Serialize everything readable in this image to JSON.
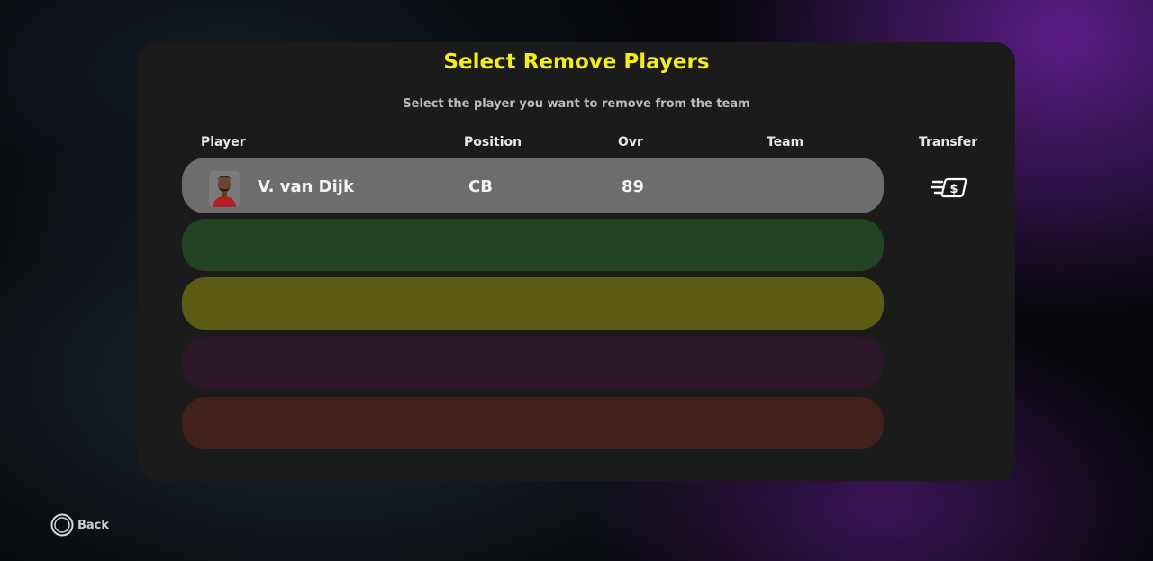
{
  "dialog": {
    "title": "Select Remove Players",
    "subtitle": "Select the player you want to remove from the team"
  },
  "columns": {
    "player": "Player",
    "position": "Position",
    "ovr": "Ovr",
    "team": "Team",
    "transfer": "Transfer"
  },
  "rows": [
    {
      "name": "V. van Dijk",
      "position": "CB",
      "ovr": "89",
      "team": "",
      "color": "#6d6d6d"
    },
    {
      "name": "",
      "position": "",
      "ovr": "",
      "team": "",
      "color": "#234423"
    },
    {
      "name": "",
      "position": "",
      "ovr": "",
      "team": "",
      "color": "#5d5c16"
    },
    {
      "name": "",
      "position": "",
      "ovr": "",
      "team": "",
      "color": "#2b1727"
    },
    {
      "name": "",
      "position": "",
      "ovr": "",
      "team": "",
      "color": "#43211e"
    }
  ],
  "icons": {
    "transfer": "transfer-money-icon",
    "back": "circle-button-icon"
  },
  "footer": {
    "back_label": "Back"
  },
  "colors": {
    "title": "#f2ee1c",
    "panel": "#1b1b1b"
  }
}
